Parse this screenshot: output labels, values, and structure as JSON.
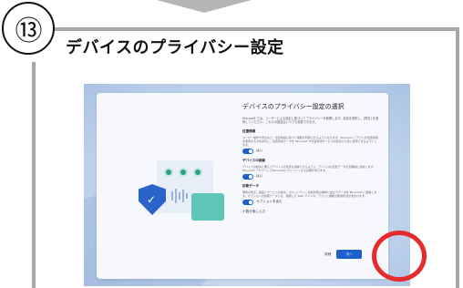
{
  "step": {
    "number": "⑬",
    "title": "デバイスのプライバシー設定"
  },
  "oobe": {
    "title": "デバイスのプライバシー設定の選択",
    "description": "Microsoft では、ユーザーによる設定に基づいてプライバシーを管理します。設定を選択し、[同意] を選択してください。これらの設定はいつでも変更できます。",
    "sections": [
      {
        "heading": "位置情報",
        "text": "ユーザー操作や天気など、位置情報に基づく機能を利用できるようになります。Windows とアプリが位置情報を使用するのを許可し、位置情報データを Microsoft が位置情報サービスの改善のために使用できるようにします。",
        "toggle_label": "はい"
      },
      {
        "heading": "デバイスの検索",
        "text": "デバイスの紛失に備えてデバイスの位置を追跡できるように、デバイスの位置データを定期的に送信します。Microsoft アカウントでWindowsにサインインする必要があります。",
        "toggle_label": "はい"
      },
      {
        "heading": "診断データ",
        "text": "問題の修正、製品とサービスの改善、セキュリティと最新状態の維持に役立つデータを Microsoft に送信します。オプションの診断データには、閲覧した Web サイトや、アプリと機能の使用状況が含まれます。",
        "toggle_label": "オプションを含む"
      }
    ],
    "extra_link": "十数分後に入力",
    "more_label": "詳細",
    "next_label": "次へ"
  },
  "colors": {
    "highlight": "#e52b2b",
    "accent": "#1e5fcf",
    "frame": "#a8a8a8"
  }
}
